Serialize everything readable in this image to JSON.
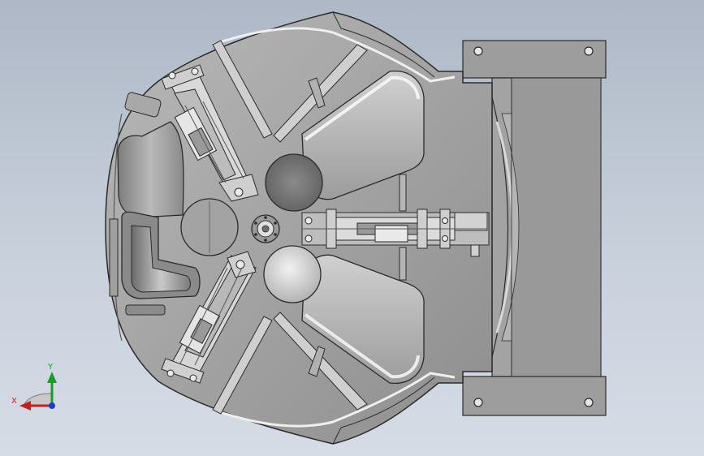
{
  "triad": {
    "x_label": "X",
    "y_label": "Y",
    "x_color": "#c81e1e",
    "y_color": "#1e9a2a",
    "z_color": "#1e3fc8"
  },
  "colors": {
    "body": "#9a9a9a",
    "body_light": "#c4c4c4",
    "body_dark": "#6e6e6e",
    "edge": "#2b2b2b",
    "background_top": "#aeb8c6",
    "background_bottom": "#d6dce6"
  }
}
